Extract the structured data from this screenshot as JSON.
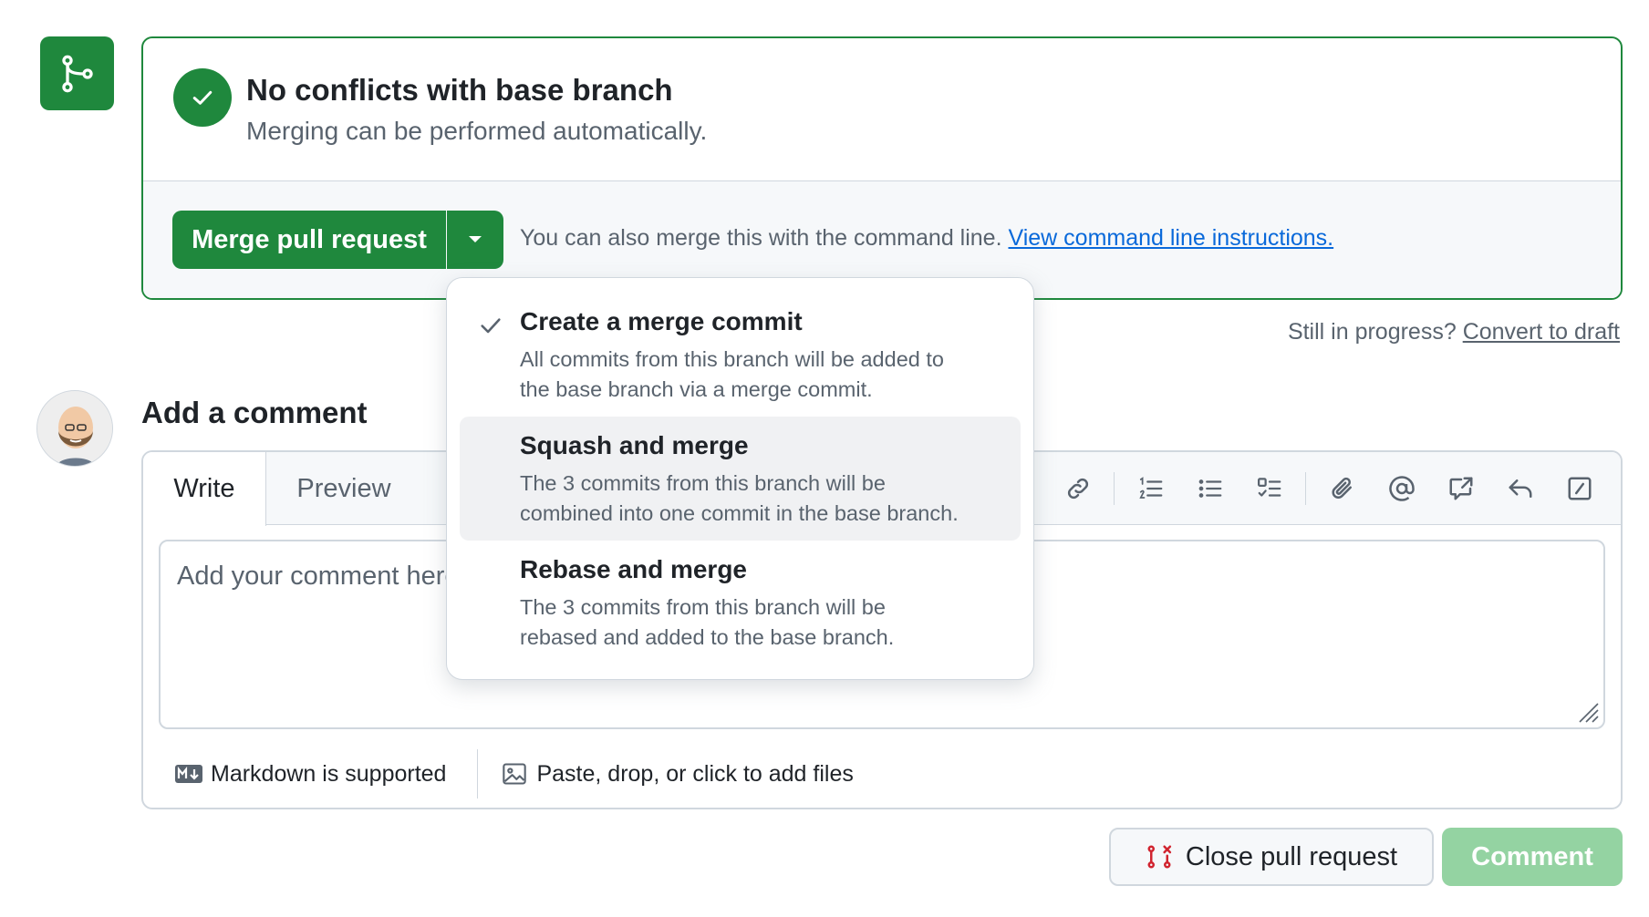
{
  "merge": {
    "title": "No conflicts with base branch",
    "subtitle": "Merging can be performed automatically.",
    "button_label": "Merge pull request",
    "hint_text": "You can also merge this with the command line. ",
    "hint_link": "View command line instructions."
  },
  "draft": {
    "prefix": "Still in progress? ",
    "link": "Convert to draft"
  },
  "merge_options": [
    {
      "title": "Create a merge commit",
      "desc_line1": "All commits from this branch will be added to",
      "desc_line2": "the base branch via a merge commit.",
      "selected": true
    },
    {
      "title": "Squash and merge",
      "desc_line1": "The 3 commits from this branch will be",
      "desc_line2": "combined into one commit in the base branch.",
      "selected": false
    },
    {
      "title": "Rebase and merge",
      "desc_line1": "The 3 commits from this branch will be",
      "desc_line2": "rebased and added to the base branch.",
      "selected": false
    }
  ],
  "comment": {
    "heading": "Add a comment",
    "tab_write": "Write",
    "tab_preview": "Preview",
    "placeholder": "Add your comment here...",
    "markdown_note": "Markdown is supported",
    "files_note": "Paste, drop, or click to add files"
  },
  "toolbar_icons": [
    "link-icon",
    "ordered-list-icon",
    "unordered-list-icon",
    "task-list-icon",
    "attach-icon",
    "mention-icon",
    "cross-reference-icon",
    "reply-icon",
    "slash-command-icon"
  ],
  "actions": {
    "close_label": "Close pull request",
    "comment_label": "Comment"
  },
  "colors": {
    "success": "#1f883d",
    "success_disabled": "#94d3a2",
    "link": "#0969da",
    "danger": "#d1242f"
  }
}
